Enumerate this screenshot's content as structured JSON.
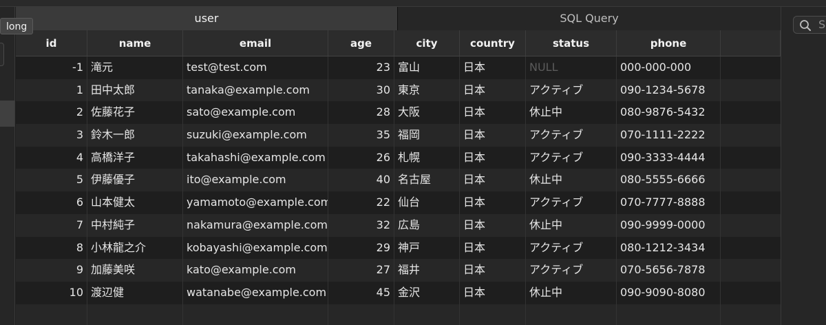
{
  "tooltip": "long",
  "tabs": [
    {
      "label": "user",
      "active": true
    },
    {
      "label": "SQL Query",
      "active": false
    }
  ],
  "search": {
    "placeholder_visible": "S"
  },
  "columns": [
    "id",
    "name",
    "email",
    "age",
    "city",
    "country",
    "status",
    "phone"
  ],
  "rows": [
    {
      "id": "-1",
      "name": "滝元",
      "email": "test@test.com",
      "age": "23",
      "city": "富山",
      "country": "日本",
      "status": "NULL",
      "phone": "000-000-000"
    },
    {
      "id": "1",
      "name": "田中太郎",
      "email": "tanaka@example.com",
      "age": "30",
      "city": "東京",
      "country": "日本",
      "status": "アクティブ",
      "phone": "090-1234-5678"
    },
    {
      "id": "2",
      "name": "佐藤花子",
      "email": "sato@example.com",
      "age": "28",
      "city": "大阪",
      "country": "日本",
      "status": "休止中",
      "phone": "080-9876-5432"
    },
    {
      "id": "3",
      "name": "鈴木一郎",
      "email": "suzuki@example.com",
      "age": "35",
      "city": "福岡",
      "country": "日本",
      "status": "アクティブ",
      "phone": "070-1111-2222"
    },
    {
      "id": "4",
      "name": "高橋洋子",
      "email": "takahashi@example.com",
      "age": "26",
      "city": "札幌",
      "country": "日本",
      "status": "アクティブ",
      "phone": "090-3333-4444"
    },
    {
      "id": "5",
      "name": "伊藤優子",
      "email": "ito@example.com",
      "age": "40",
      "city": "名古屋",
      "country": "日本",
      "status": "休止中",
      "phone": "080-5555-6666"
    },
    {
      "id": "6",
      "name": "山本健太",
      "email": "yamamoto@example.com",
      "age": "22",
      "city": "仙台",
      "country": "日本",
      "status": "アクティブ",
      "phone": "070-7777-8888"
    },
    {
      "id": "7",
      "name": "中村純子",
      "email": "nakamura@example.com",
      "age": "32",
      "city": "広島",
      "country": "日本",
      "status": "休止中",
      "phone": "090-9999-0000"
    },
    {
      "id": "8",
      "name": "小林龍之介",
      "email": "kobayashi@example.com",
      "age": "29",
      "city": "神戸",
      "country": "日本",
      "status": "アクティブ",
      "phone": "080-1212-3434"
    },
    {
      "id": "9",
      "name": "加藤美咲",
      "email": "kato@example.com",
      "age": "27",
      "city": "福井",
      "country": "日本",
      "status": "アクティブ",
      "phone": "070-5656-7878"
    },
    {
      "id": "10",
      "name": "渡辺健",
      "email": "watanabe@example.com",
      "age": "45",
      "city": "金沢",
      "country": "日本",
      "status": "休止中",
      "phone": "090-9090-8080"
    }
  ]
}
